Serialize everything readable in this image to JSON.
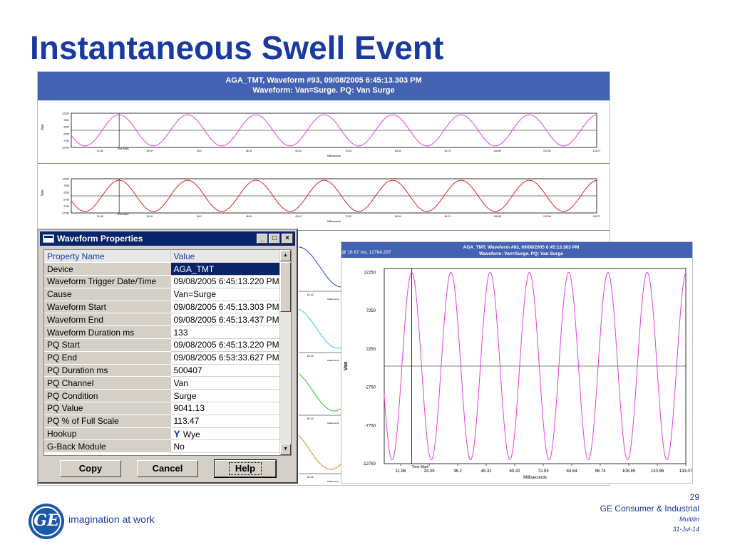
{
  "slide": {
    "title": "Instantaneous Swell Event",
    "tagline": "imagination at work",
    "logo_text": "GE",
    "page_number": "29",
    "company": "GE Consumer & Industrial",
    "division": "Multilin",
    "date": "31-Jul-14"
  },
  "panel": {
    "title_line1": "AGA_TMT, Waveform #93, 09/08/2005 6:45:13.303 PM",
    "title_line2": "Waveform: Van=Surge. PQ: Van Surge",
    "xlabel": "Milliseconds",
    "cursor_label": "Time Mark",
    "ytick_labels": [
      "12250",
      "7250",
      "2250",
      "-2750",
      "-7750",
      "-12750"
    ],
    "xtick_labels": [
      "11.98",
      "24.09",
      "36.2",
      "48.31",
      "60.42",
      "72.53",
      "84.64",
      "96.74",
      "108.85",
      "120.96",
      "133.07"
    ],
    "partial_tick": "60.42",
    "strips": [
      {
        "ylabel": "Van",
        "color": "#e040e0"
      },
      {
        "ylabel": "Van",
        "color": "#e02020"
      }
    ],
    "partial_strip_colors": [
      "#2040c0",
      "#20d0e0",
      "#20c020",
      "#e08020"
    ]
  },
  "dialog": {
    "title": "Waveform Properties",
    "buttons": {
      "minimize": "_",
      "maximize": "□",
      "close": "×"
    },
    "columns": [
      "Property Name",
      "Value"
    ],
    "rows": [
      {
        "name": "Device",
        "value": "AGA_TMT"
      },
      {
        "name": "Waveform Trigger Date/Time",
        "value": "09/08/2005 6:45:13.220 PM"
      },
      {
        "name": "Cause",
        "value": "Van=Surge"
      },
      {
        "name": "Waveform Start",
        "value": "09/08/2005 6:45:13.303 PM"
      },
      {
        "name": "Waveform End",
        "value": "09/08/2005 6:45:13.437 PM"
      },
      {
        "name": "Waveform Duration ms",
        "value": "133"
      },
      {
        "name": "PQ Start",
        "value": "09/08/2005 6:45:13.220 PM"
      },
      {
        "name": "PQ End",
        "value": "09/08/2005 6:53:33.627 PM"
      },
      {
        "name": "PQ Duration ms",
        "value": "500407"
      },
      {
        "name": "PQ Channel",
        "value": "Van"
      },
      {
        "name": "PQ Condition",
        "value": "Surge"
      },
      {
        "name": "PQ Value",
        "value": "9041.13"
      },
      {
        "name": "PQ % of Full Scale",
        "value": "113.47"
      },
      {
        "name": "Hookup",
        "value": "Wye",
        "icon": "Y"
      },
      {
        "name": "G-Back Module",
        "value": "No"
      }
    ],
    "copy_label": "Copy",
    "cancel_label": "Cancel",
    "help_label": "Help"
  },
  "zoom_chart": {
    "title_line1": "AGA_TMT, Waveform #93, 09/08/2005 6:45:13.303 PM",
    "title_line2": "Waveform: Van=Surge. PQ: Van Surge",
    "cursor_readout": "@ 16.67 ms, 12784.297",
    "ylabel": "Van",
    "xlabel": "Milliseconds",
    "cursor_label": "Time Mark",
    "color": "#e040e0"
  },
  "chart_data": {
    "type": "line",
    "title": "AGA_TMT, Waveform #93, 09/08/2005 6:45:13.303 PM",
    "subtitle": "Waveform: Van=Surge. PQ: Van Surge",
    "xlabel": "Milliseconds",
    "ylabel": "Van",
    "x_ticks": [
      11.98,
      24.09,
      36.2,
      48.31,
      60.42,
      72.53,
      84.64,
      96.74,
      108.85,
      120.96,
      133.07
    ],
    "y_ticks": [
      12250,
      7250,
      2250,
      -2750,
      -7750,
      -12750
    ],
    "xlim": [
      5.0,
      133.07
    ],
    "ylim": [
      -12750,
      12750
    ],
    "series": [
      {
        "name": "Van",
        "amplitude": 12250,
        "frequency_hz": 60,
        "peaks": 8
      }
    ],
    "cursor": {
      "x": 16.67,
      "y": 12784.297
    }
  }
}
